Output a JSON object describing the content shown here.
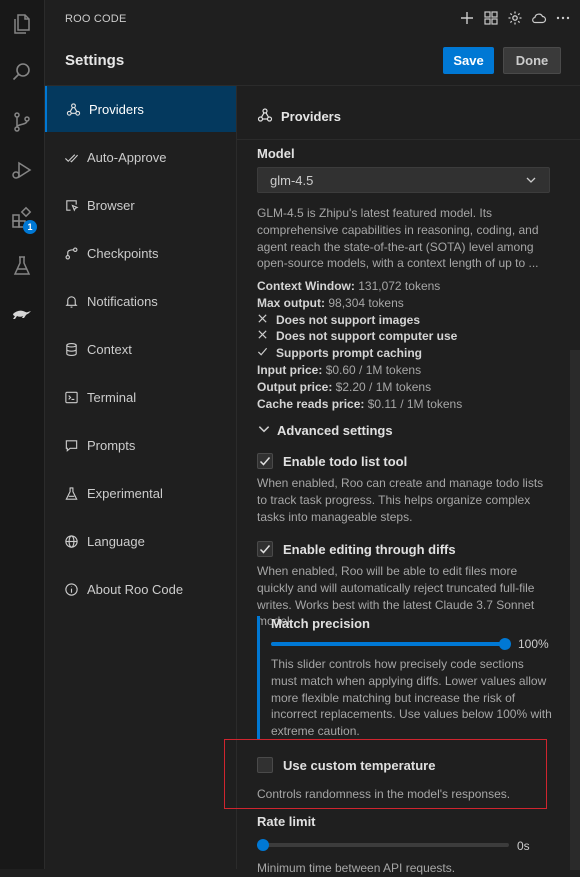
{
  "app_title": "ROO CODE",
  "header": {
    "title": "Settings",
    "save_label": "Save",
    "done_label": "Done"
  },
  "activity_bar": {
    "extensions_badge": "1"
  },
  "nav": {
    "items": [
      {
        "label": "Providers",
        "icon": "webhook-icon",
        "active": true
      },
      {
        "label": "Auto-Approve",
        "icon": "check-check-icon"
      },
      {
        "label": "Browser",
        "icon": "browser-cursor-icon"
      },
      {
        "label": "Checkpoints",
        "icon": "git-commit-icon"
      },
      {
        "label": "Notifications",
        "icon": "bell-icon"
      },
      {
        "label": "Context",
        "icon": "database-icon"
      },
      {
        "label": "Terminal",
        "icon": "terminal-icon"
      },
      {
        "label": "Prompts",
        "icon": "message-icon"
      },
      {
        "label": "Experimental",
        "icon": "flask-icon"
      },
      {
        "label": "Language",
        "icon": "globe-icon"
      },
      {
        "label": "About Roo Code",
        "icon": "info-icon"
      }
    ]
  },
  "content": {
    "section_title": "Providers",
    "model_label": "Model",
    "model_value": "glm-4.5",
    "model_description": "GLM-4.5 is Zhipu's latest featured model. Its comprehensive capabilities in reasoning, coding, and agent reach the state-of-the-art (SOTA) level among open-source models, with a context length of up to ...",
    "context_window_label": "Context Window:",
    "context_window_value": "131,072 tokens",
    "max_output_label": "Max output:",
    "max_output_value": "98,304 tokens",
    "no_images": "Does not support images",
    "no_computer_use": "Does not support computer use",
    "prompt_caching": "Supports prompt caching",
    "input_price_label": "Input price:",
    "input_price_value": "$0.60 / 1M tokens",
    "output_price_label": "Output price:",
    "output_price_value": "$2.20 / 1M tokens",
    "cache_reads_label": "Cache reads price:",
    "cache_reads_value": "$0.11 / 1M tokens",
    "advanced_label": "Advanced settings",
    "todo_label": "Enable todo list tool",
    "todo_checked": true,
    "todo_desc": "When enabled, Roo can create and manage todo lists to track task progress. This helps organize complex tasks into manageable steps.",
    "diffs_label": "Enable editing through diffs",
    "diffs_checked": true,
    "diffs_desc": "When enabled, Roo will be able to edit files more quickly and will automatically reject truncated full-file writes. Works best with the latest Claude 3.7 Sonnet model.",
    "match_precision_label": "Match precision",
    "match_precision_value": "100%",
    "match_precision_level": 1.0,
    "match_precision_desc": "This slider controls how precisely code sections must match when applying diffs. Lower values allow more flexible matching but increase the risk of incorrect replacements. Use values below 100% with extreme caution.",
    "temperature_label": "Use custom temperature",
    "temperature_checked": false,
    "temperature_desc": "Controls randomness in the model's responses.",
    "rate_limit_label": "Rate limit",
    "rate_limit_value": "0s",
    "rate_limit_level": 0,
    "rate_limit_desc": "Minimum time between API requests."
  },
  "colors": {
    "accent": "#0078d4",
    "highlight_border": "#d0252f",
    "background": "#1f1f1f"
  }
}
